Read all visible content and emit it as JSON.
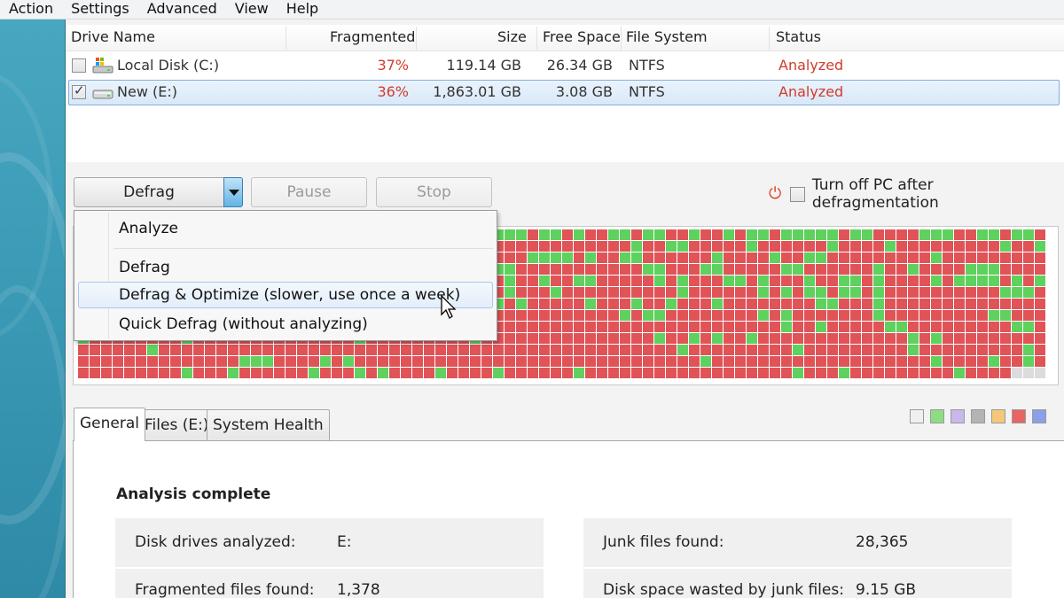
{
  "menu": [
    "Action",
    "Settings",
    "Advanced",
    "View",
    "Help"
  ],
  "drive_table": {
    "columns": {
      "drive_name": "Drive Name",
      "fragmented": "Fragmented",
      "size": "Size",
      "free_space": "Free Space",
      "file_system": "File System",
      "status": "Status"
    },
    "rows": [
      {
        "name": "Local Disk (C:)",
        "fragmented": "37%",
        "size": "119.14 GB",
        "free_space": "26.34 GB",
        "file_system": "NTFS",
        "status": "Analyzed",
        "checked": false,
        "icon": "system-drive-icon"
      },
      {
        "name": "New (E:)",
        "fragmented": "36%",
        "size": "1,863.01 GB",
        "free_space": "3.08 GB",
        "file_system": "NTFS",
        "status": "Analyzed",
        "checked": true,
        "icon": "hard-drive-icon"
      }
    ]
  },
  "toolbar": {
    "defrag_label": "Defrag",
    "pause_label": "Pause",
    "stop_label": "Stop",
    "turn_off_label": "Turn off PC after defragmentation"
  },
  "dropdown": {
    "items": [
      "Analyze",
      "Defrag",
      "Defrag & Optimize (slower, use once a week)",
      "Quick Defrag (without analyzing)"
    ],
    "hovered": "Defrag & Optimize (slower, use once a week)"
  },
  "disk_map": {
    "colors": {
      "fragmented": "#e05458",
      "free": "#5fd15e",
      "empty": "#dcdcdc",
      "border": "#ffffff"
    }
  },
  "tabs": [
    "General",
    "Files (E:)",
    "System Health"
  ],
  "active_tab": "General",
  "legend_colors": [
    "#f0f0f0",
    "#8ddc86",
    "#c8b8ec",
    "#b4b4b4",
    "#f5c77a",
    "#e86565",
    "#8aa0e8"
  ],
  "general": {
    "title": "Analysis complete",
    "stats_left": [
      {
        "label": "Disk drives analyzed:",
        "value": "E:"
      },
      {
        "label": "Fragmented files found:",
        "value": "1,378"
      }
    ],
    "stats_right": [
      {
        "label": "Junk files found:",
        "value": "28,365"
      },
      {
        "label": "Disk space wasted by junk files:",
        "value": "9.15 GB"
      }
    ]
  }
}
